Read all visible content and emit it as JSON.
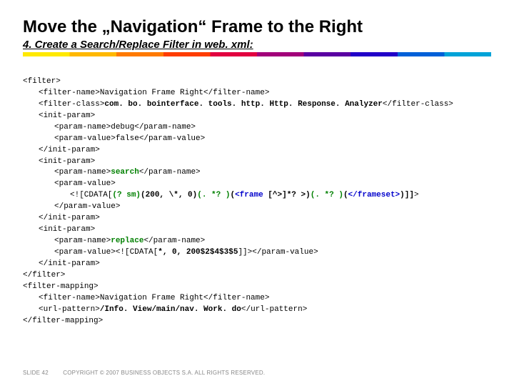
{
  "title": "Move the „Navigation“ Frame to the Right",
  "subtitle": "4. Create a Search/Replace Filter in web. xml:",
  "code": {
    "l01": "<filter>",
    "l02": "<filter-name>Navigation Frame Right</filter-name>",
    "l03a": "<filter-class>",
    "l03b": "com. bo. bointerface. tools. http. Http. Response. Analyzer",
    "l03c": "</filter-class>",
    "l04": "<init-param>",
    "l05": "<param-name>debug</param-name>",
    "l06": "<param-value>false</param-value>",
    "l07": "</init-param>",
    "l08": "<init-param>",
    "l09a": "<param-name>",
    "l09b": "search",
    "l09c": "</param-name>",
    "l10": "<param-value>",
    "l11a": "<![CDATA[",
    "l11b": "(? sm)",
    "l11c": "(200, \\*, 0)",
    "l11d": "(. *? )",
    "l11e": "(",
    "l11f": "<frame ",
    "l11g": "[^>]*? >)",
    "l11h": "(. *? )",
    "l11i": "(",
    "l11j": "</frameset>",
    "l11k": ")]]",
    "l11l": ">",
    "l12": "</param-value>",
    "l13": "</init-param>",
    "l14": "<init-param>",
    "l15a": "<param-name>",
    "l15b": "replace",
    "l15c": "</param-name>",
    "l16a": "<param-value><![CDATA[",
    "l16b": "*, 0, 200$2$4$3$5",
    "l16c": "]]></param-value>",
    "l17": "</init-param>",
    "l18": "</filter>",
    "l19": "<filter-mapping>",
    "l20": "<filter-name>Navigation Frame Right</filter-name>",
    "l21a": "<url-pattern>",
    "l21b": "/Info. View/main/nav. Work. do",
    "l21c": "</url-pattern>",
    "l22": "</filter-mapping>"
  },
  "footer": {
    "slide": "SLIDE 42",
    "copyright": "COPYRIGHT © 2007 BUSINESS OBJECTS S.A. ALL RIGHTS RESERVED."
  }
}
